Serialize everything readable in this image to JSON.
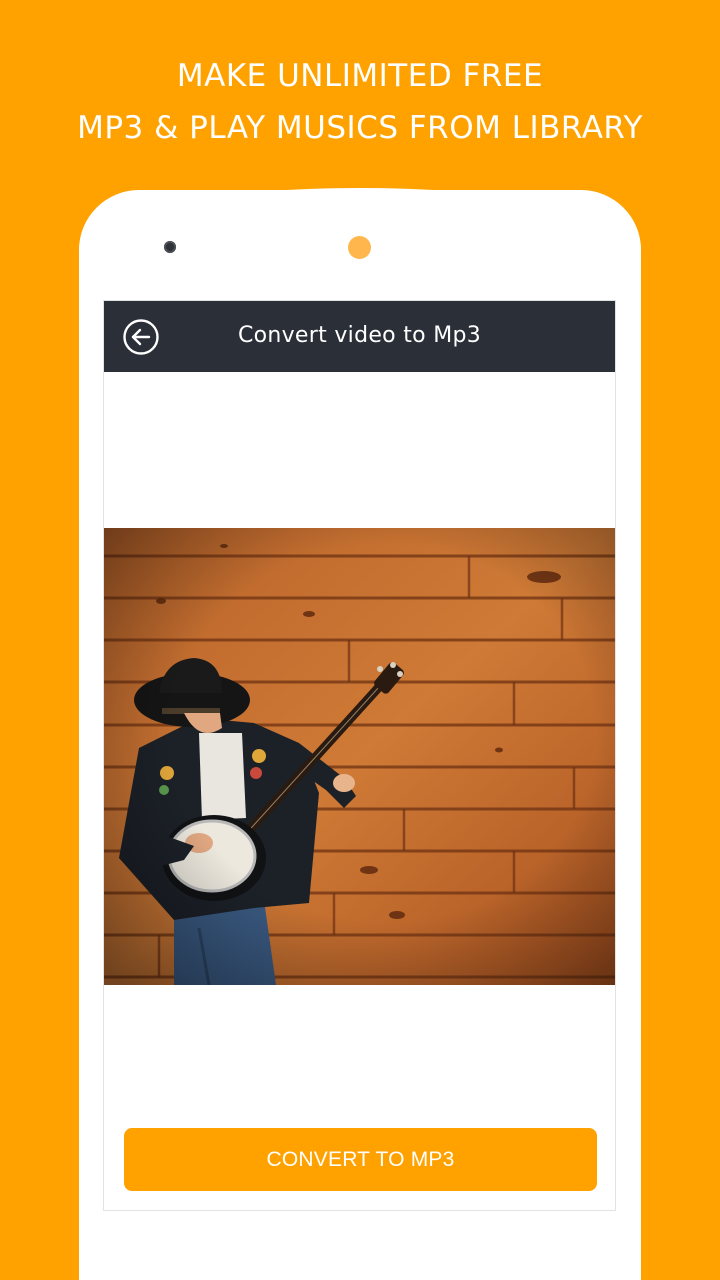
{
  "promo": {
    "line1": "MAKE UNLIMITED FREE",
    "line2": "MP3 & PLAY MUSICS FROM LIBRARY"
  },
  "toolbar": {
    "title": "Convert video to Mp3",
    "back_icon": "arrow-left-circle-icon"
  },
  "media": {
    "description_icon": "video-thumbnail"
  },
  "actions": {
    "convert_label": "CONVERT TO MP3"
  },
  "colors": {
    "accent": "#FFA200",
    "toolbar": "#2B3038",
    "sensor": "#FFB74D"
  }
}
